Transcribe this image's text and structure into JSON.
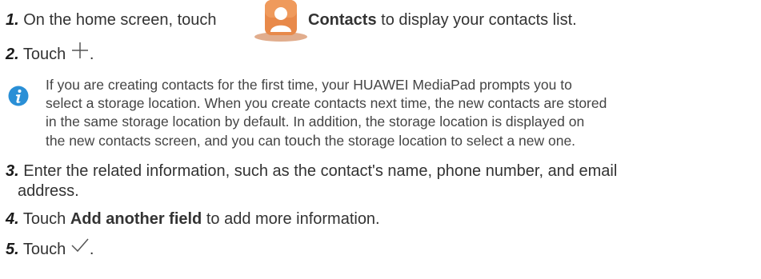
{
  "steps": [
    {
      "number": "1.",
      "before": "On the home screen, touch ",
      "icon": "contacts-app-icon",
      "bold": "Contacts",
      "after": " to display your contacts list."
    },
    {
      "number": "2.",
      "before": "Touch ",
      "icon": "plus-icon",
      "after": "."
    },
    {
      "number": "3.",
      "line1": "Enter the related information, such as the contact's name, phone number, and email",
      "line2": "address."
    },
    {
      "number": "4.",
      "before": "Touch ",
      "bold": "Add another field",
      "after": " to add more information."
    },
    {
      "number": "5.",
      "before": "Touch ",
      "icon": "checkmark-icon",
      "after": "."
    }
  ],
  "note": {
    "icon": "info-icon",
    "line1": "If you are creating contacts for the first time, your HUAWEI MediaPad prompts you to",
    "line2": "select a storage location. When you create contacts next time, the new contacts are stored",
    "line3": "in the same storage location by default. In addition, the storage location is displayed on",
    "line4a": "the new contacts screen, and you can ",
    "line4b": "touch",
    "line4c": " the storage location to select a new one."
  },
  "colors": {
    "contacts_icon_orange": "#e8894a",
    "info_icon_blue": "#2a8fd6"
  }
}
